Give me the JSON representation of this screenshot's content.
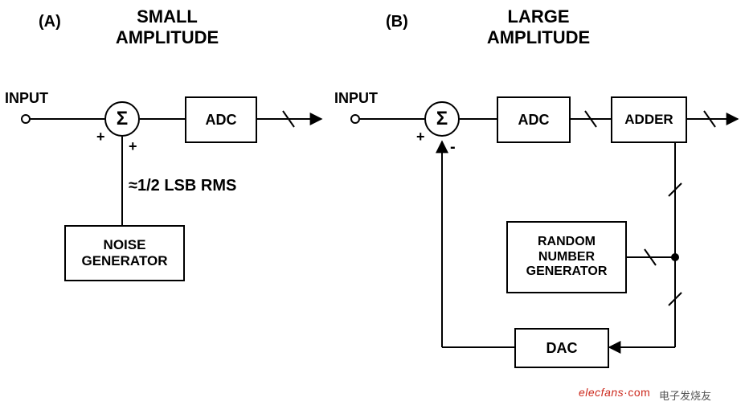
{
  "diagramA": {
    "tag": "(A)",
    "title": "SMALL\nAMPLITUDE",
    "input_label": "INPUT",
    "summer": {
      "symbol": "Σ",
      "top_sign": "+",
      "bottom_sign": "+"
    },
    "adc_label": "ADC",
    "noise_annotation": "≈1/2 LSB RMS",
    "noise_gen_label": "NOISE\nGENERATOR"
  },
  "diagramB": {
    "tag": "(B)",
    "title": "LARGE\nAMPLITUDE",
    "input_label": "INPUT",
    "summer": {
      "symbol": "Σ",
      "top_sign": "+",
      "bottom_sign": "-"
    },
    "adc_label": "ADC",
    "adder_label": "ADDER",
    "rng_label": "RANDOM\nNUMBER\nGENERATOR",
    "dac_label": "DAC"
  },
  "watermark": {
    "brand": "elecfans",
    "dotcom": "·com",
    "cn": "电子发烧友"
  }
}
